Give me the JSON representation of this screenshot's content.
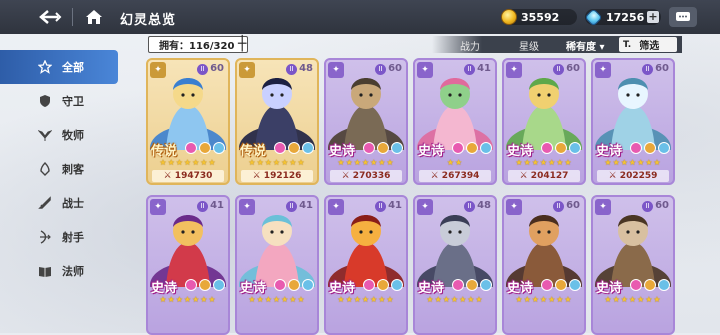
{
  "header": {
    "title": "幻灵总览",
    "gold": "35592",
    "gems": "17256"
  },
  "sidebar": {
    "items": [
      {
        "label": "全部",
        "icon": "star-icon",
        "active": true
      },
      {
        "label": "守卫",
        "icon": "shield-icon",
        "active": false
      },
      {
        "label": "牧师",
        "icon": "wings-icon",
        "active": false
      },
      {
        "label": "刺客",
        "icon": "dagger-icon",
        "active": false
      },
      {
        "label": "战士",
        "icon": "sword-icon",
        "active": false
      },
      {
        "label": "射手",
        "icon": "bow-icon",
        "active": false
      },
      {
        "label": "法师",
        "icon": "book-icon",
        "active": false
      }
    ]
  },
  "filters": {
    "owned": "拥有：116/320",
    "sort_power": "战力",
    "sort_star": "星级",
    "sort_rarity": "稀有度 ▾",
    "filter_label": "筛选",
    "filter_icon": "T."
  },
  "cards": [
    {
      "rank": "传说",
      "level": "60",
      "power": "⚔ 194730",
      "stars": "★★★★★★★",
      "tier": "legend",
      "art": "blue-dragon"
    },
    {
      "rank": "传说",
      "level": "48",
      "power": "⚔ 192126",
      "stars": "★★★★★★★",
      "tier": "legend",
      "art": "dark-knight"
    },
    {
      "rank": "史诗",
      "level": "60",
      "power": "⚔ 270336",
      "stars": "★★★★★★★",
      "tier": "epic",
      "art": "brute"
    },
    {
      "rank": "史诗",
      "level": "41",
      "power": "⚔ 267394",
      "stars": "★★",
      "tier": "epic",
      "art": "flower-girl"
    },
    {
      "rank": "史诗",
      "level": "60",
      "power": "⚔ 204127",
      "stars": "★★★★★★★",
      "tier": "epic",
      "art": "dryad"
    },
    {
      "rank": "史诗",
      "level": "60",
      "power": "⚔ 202259",
      "stars": "★★★★★★★",
      "tier": "epic",
      "art": "ghost-girl"
    },
    {
      "rank": "史诗",
      "level": "41",
      "power": "",
      "stars": "★★★★★★★",
      "tier": "epic",
      "art": "red-witch"
    },
    {
      "rank": "史诗",
      "level": "41",
      "power": "",
      "stars": "★★★★★★★",
      "tier": "epic",
      "art": "mermaid"
    },
    {
      "rank": "史诗",
      "level": "41",
      "power": "",
      "stars": "★★★★★★★",
      "tier": "epic",
      "art": "imp"
    },
    {
      "rank": "史诗",
      "level": "48",
      "power": "",
      "stars": "★★★★★★★",
      "tier": "epic",
      "art": "werewolf"
    },
    {
      "rank": "史诗",
      "level": "60",
      "power": "",
      "stars": "★★★★★★★",
      "tier": "epic",
      "art": "cyclops"
    },
    {
      "rank": "史诗",
      "level": "60",
      "power": "",
      "stars": "★★★★★★★",
      "tier": "epic",
      "art": "minotaur"
    }
  ]
}
